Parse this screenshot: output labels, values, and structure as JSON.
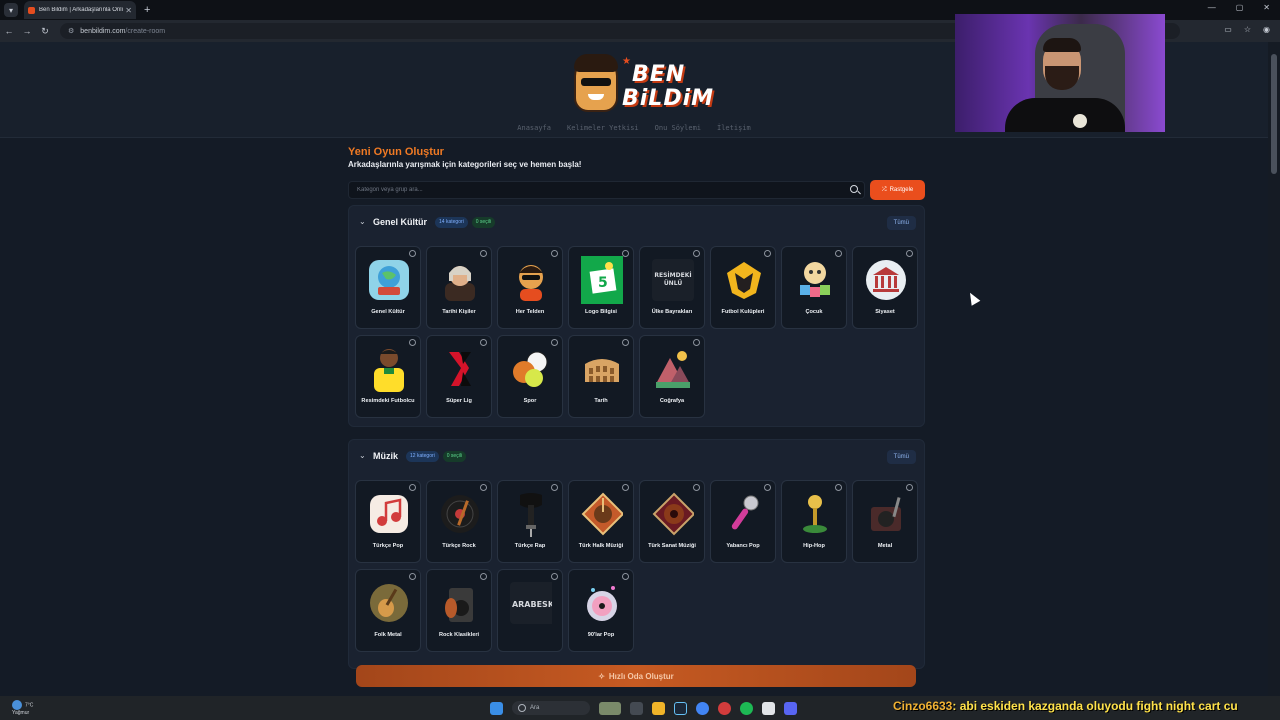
{
  "browser": {
    "tab_title": "Ben Bildim | Arkadaşlarınla Onli...",
    "url_host": "benbildim.com",
    "url_path": "/create-room"
  },
  "site": {
    "logo_line1": "BEN",
    "logo_line2": "BiLDiM",
    "nav": [
      "Anasayfa",
      "Kelimeler Yetkisi",
      "Onu Söylemi",
      "İletişim"
    ]
  },
  "page": {
    "title": "Yeni Oyun Oluştur",
    "subtitle": "Arkadaşlarınla yarışmak için kategorileri seç ve hemen başla!",
    "search_placeholder": "Kategori veya grup ara...",
    "random_label": "Rastgele",
    "cta_label": "Hızlı Oda Oluştur"
  },
  "sections": [
    {
      "title": "Genel Kültür",
      "count_badge": "14 kategori",
      "selected_badge": "0 seçili",
      "all_label": "Tümü",
      "cards": [
        "Genel Kültür",
        "Tarihi Kişiler",
        "Her Telden",
        "Logo Bilgisi",
        "Ülke Bayrakları",
        "Futbol Kulüpleri",
        "Çocuk",
        "Siyaset",
        "Resimdeki Futbolcu",
        "Süper Lig",
        "Spor",
        "Tarih",
        "Coğrafya"
      ],
      "card_icons": [
        "globe-book-icon",
        "historical-portrait-icon",
        "mascot-icon",
        "logo-quiz-icon",
        "flag-question-icon",
        "wolf-crest-icon",
        "toys-icon",
        "government-building-icon",
        "footballer-icon",
        "super-lig-logo-icon",
        "sports-balls-icon",
        "colosseum-icon",
        "mountain-landscape-icon"
      ]
    },
    {
      "title": "Müzik",
      "count_badge": "12 kategori",
      "selected_badge": "0 seçili",
      "all_label": "Tümü",
      "cards": [
        "Türkçe Pop",
        "Türkçe Rock",
        "Türkçe Rap",
        "Türk Halk Müziği",
        "Türk Sanat Müziği",
        "Yabancı Pop",
        "Hip-Hop",
        "Metal",
        "Folk Metal",
        "Rock Klasikleri",
        "",
        "90'lar Pop"
      ],
      "card_icons": [
        "music-notes-icon",
        "vinyl-guitar-icon",
        "rap-microphone-icon",
        "folk-saz-icon",
        "oud-icon",
        "microphone-icon",
        "gold-microphone-icon",
        "metal-amp-icon",
        "folk-guitar-icon",
        "amplifier-guitar-icon",
        "arabesk-text-icon",
        "cd-disc-icon"
      ]
    }
  ],
  "card_image_text": {
    "resimdeki_unlu": "RESİMDEKİ ÜNLÜ",
    "arabesk": "ARABESK",
    "logo_number": "5"
  },
  "taskbar": {
    "weather_temp": "7°C",
    "weather_desc": "Yağmur",
    "search_label": "Ara"
  },
  "chat_ticker": {
    "user": "Cinzo6633",
    "message": ": abi eskiden kazganda oluyodu fight night cart cu"
  },
  "colors": {
    "accent": "#ea4e1d",
    "title_orange": "#f07a24",
    "bg": "#141b26",
    "card_bg": "#121923"
  }
}
